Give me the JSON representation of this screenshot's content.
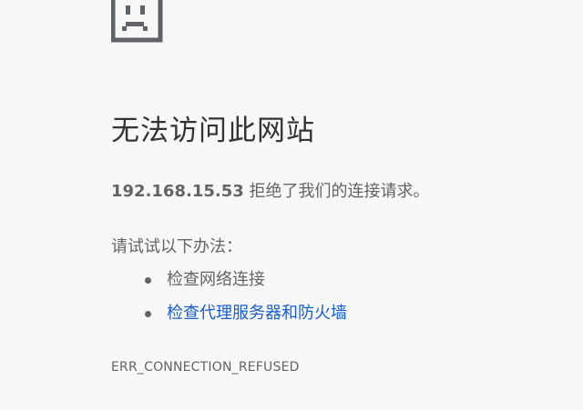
{
  "error_page": {
    "icon": "sad-page-icon",
    "title": "无法访问此网站",
    "summary": {
      "host": "192.168.15.53",
      "message": " 拒绝了我们的连接请求。"
    },
    "suggestions_heading": "请试试以下办法：",
    "suggestions": [
      {
        "text": "检查网络连接",
        "is_link": false
      },
      {
        "text": "检查代理服务器和防火墙",
        "is_link": true
      }
    ],
    "error_code": "ERR_CONNECTION_REFUSED",
    "colors": {
      "background": "#f7f7f7",
      "title": "#333333",
      "body_text": "#646464",
      "link": "#1a5fd1"
    }
  }
}
